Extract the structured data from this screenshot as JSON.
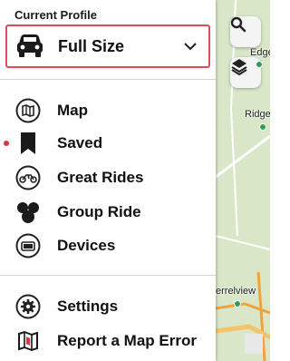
{
  "drawer": {
    "section_title": "Current Profile",
    "profile": {
      "label": "Full Size",
      "icon": "car-icon",
      "dropdown_icon": "chevron-down-icon"
    },
    "menu": [
      {
        "label": "Map",
        "icon": "map-icon"
      },
      {
        "label": "Saved",
        "icon": "bookmark-icon",
        "has_notification_dot": true
      },
      {
        "label": "Great Rides",
        "icon": "motorcycle-icon"
      },
      {
        "label": "Group Ride",
        "icon": "group-icon"
      },
      {
        "label": "Devices",
        "icon": "device-icon"
      }
    ],
    "menu_secondary": [
      {
        "label": "Settings",
        "icon": "gear-icon"
      },
      {
        "label": "Report a Map Error",
        "icon": "report-map-icon"
      }
    ]
  },
  "map": {
    "search_icon": "search-icon",
    "layers_icon": "layers-icon",
    "labels": [
      "Edge",
      "Ridge",
      "errelview"
    ]
  },
  "colors": {
    "highlight_border": "#e04e55",
    "notification_dot": "#d9363e",
    "map_green": "#d9e6c8",
    "road_orange": "#f0a33a"
  }
}
